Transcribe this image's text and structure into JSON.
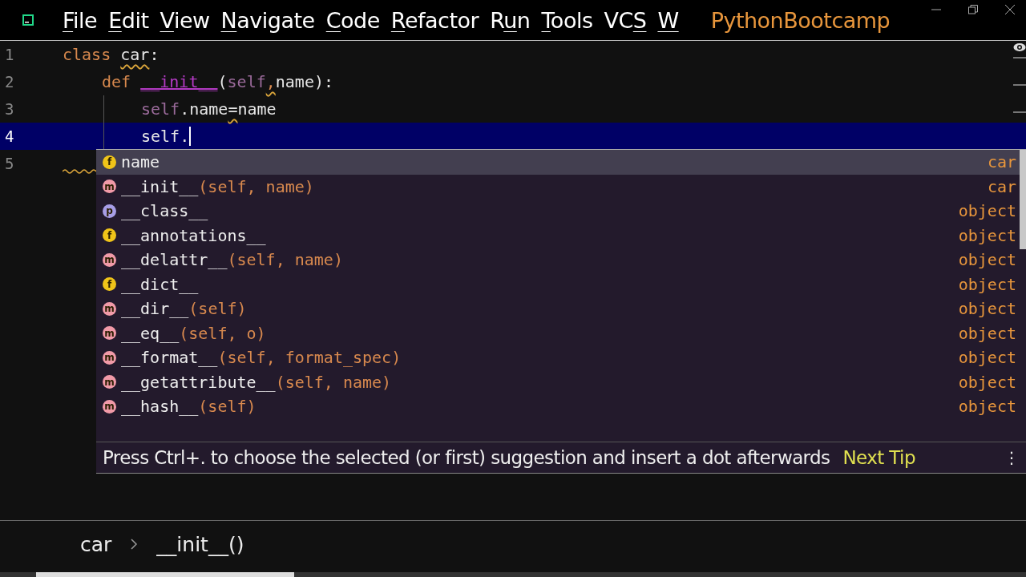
{
  "menu": [
    {
      "parts": [
        {
          "text": "F",
          "underlined": true
        },
        {
          "text": "ile",
          "underlined": false
        }
      ]
    },
    {
      "parts": [
        {
          "text": "E",
          "underlined": true
        },
        {
          "text": "dit",
          "underlined": false
        }
      ]
    },
    {
      "parts": [
        {
          "text": "V",
          "underlined": true
        },
        {
          "text": "iew",
          "underlined": false
        }
      ]
    },
    {
      "parts": [
        {
          "text": "N",
          "underlined": true
        },
        {
          "text": "avigate",
          "underlined": false
        }
      ]
    },
    {
      "parts": [
        {
          "text": "C",
          "underlined": true
        },
        {
          "text": "ode",
          "underlined": false
        }
      ]
    },
    {
      "parts": [
        {
          "text": "R",
          "underlined": true
        },
        {
          "text": "efactor",
          "underlined": false
        }
      ]
    },
    {
      "parts": [
        {
          "text": "R",
          "underlined": false
        },
        {
          "text": "u",
          "underlined": true
        },
        {
          "text": "n",
          "underlined": false
        }
      ]
    },
    {
      "parts": [
        {
          "text": "T",
          "underlined": true
        },
        {
          "text": "ools",
          "underlined": false
        }
      ]
    },
    {
      "parts": [
        {
          "text": "VC",
          "underlined": false
        },
        {
          "text": "S",
          "underlined": true
        }
      ]
    },
    {
      "parts": [
        {
          "text": "W",
          "underlined": true
        }
      ]
    }
  ],
  "project": "PythonBootcamp",
  "editor": {
    "lines": [
      {
        "number": "1",
        "current": false,
        "warning": false,
        "tokens": [
          {
            "text": "class ",
            "kind": "keyword",
            "squiggle": false
          },
          {
            "text": "car",
            "kind": "plain",
            "squiggle": true
          },
          {
            "text": ":",
            "kind": "plain",
            "squiggle": false
          }
        ],
        "children": [
          {
            "number": "2",
            "current": false,
            "warning": false,
            "tokens": [
              {
                "text": "def ",
                "kind": "keyword",
                "squiggle": false
              },
              {
                "text": "__init__",
                "kind": "magic",
                "squiggle": false
              },
              {
                "text": "(",
                "kind": "plain",
                "squiggle": false
              },
              {
                "text": "self",
                "kind": "self",
                "squiggle": false
              },
              {
                "text": ",",
                "kind": "keyword",
                "squiggle": true
              },
              {
                "text": "name):",
                "kind": "plain",
                "squiggle": false
              }
            ],
            "children": [
              {
                "number": "3",
                "current": false,
                "warning": false,
                "tokens": [
                  {
                    "text": "self",
                    "kind": "self",
                    "squiggle": false
                  },
                  {
                    "text": ".name",
                    "kind": "plain",
                    "squiggle": false
                  },
                  {
                    "text": "=",
                    "kind": "plain",
                    "squiggle": true
                  },
                  {
                    "text": "name",
                    "kind": "plain",
                    "squiggle": false
                  }
                ]
              },
              {
                "number": "4",
                "current": true,
                "warning": false,
                "tokens": [
                  {
                    "text": "self.",
                    "kind": "plain",
                    "squiggle": false
                  }
                ]
              }
            ]
          }
        ]
      },
      {
        "number": "5",
        "current": false,
        "warning": true
      }
    ]
  },
  "completion": {
    "items": [
      {
        "icon": "f",
        "kind": "field",
        "name": "name",
        "type": "car",
        "selected": true
      },
      {
        "icon": "m",
        "kind": "method",
        "name": "__init__",
        "params": "(self, name)",
        "type": "car",
        "selected": false
      },
      {
        "icon": "p",
        "kind": "property",
        "name": "__class__",
        "type": "object",
        "selected": false
      },
      {
        "icon": "f",
        "kind": "field",
        "name": "__annotations__",
        "type": "object",
        "selected": false
      },
      {
        "icon": "m",
        "kind": "method",
        "name": "__delattr__",
        "params": "(self, name)",
        "type": "object",
        "selected": false
      },
      {
        "icon": "f",
        "kind": "field",
        "name": "__dict__",
        "type": "object",
        "selected": false
      },
      {
        "icon": "m",
        "kind": "method",
        "name": "__dir__",
        "params": "(self)",
        "type": "object",
        "selected": false
      },
      {
        "icon": "m",
        "kind": "method",
        "name": "__eq__",
        "params": "(self, o)",
        "type": "object",
        "selected": false
      },
      {
        "icon": "m",
        "kind": "method",
        "name": "__format__",
        "params": "(self, format_spec)",
        "type": "object",
        "selected": false
      },
      {
        "icon": "m",
        "kind": "method",
        "name": "__getattribute__",
        "params": "(self, name)",
        "type": "object",
        "selected": false
      },
      {
        "icon": "m",
        "kind": "method",
        "name": "__hash__",
        "params": "(self)",
        "type": "object",
        "selected": false
      }
    ],
    "hint": "Press Ctrl+. to choose the selected (or first) suggestion and insert a dot afterwards",
    "next_tip": "Next Tip",
    "more": "⋮"
  },
  "breadcrumbs": [
    "car",
    "__init__()"
  ]
}
